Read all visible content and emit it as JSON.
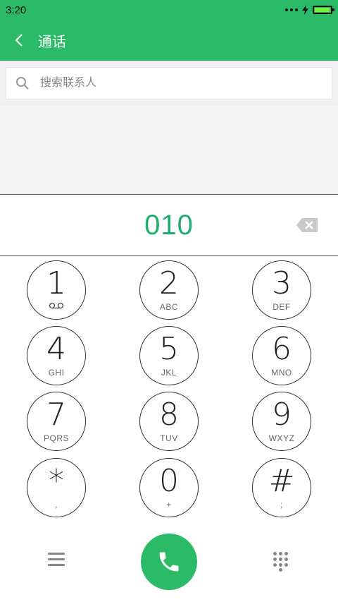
{
  "status_bar": {
    "time": "3:20",
    "battery_level": 0.95
  },
  "header": {
    "title": "通话"
  },
  "search": {
    "placeholder": "搜索联系人"
  },
  "dialer": {
    "number": "010"
  },
  "keys": [
    {
      "digit": "1",
      "sub": ""
    },
    {
      "digit": "2",
      "sub": "ABC"
    },
    {
      "digit": "3",
      "sub": "DEF"
    },
    {
      "digit": "4",
      "sub": "GHI"
    },
    {
      "digit": "5",
      "sub": "JKL"
    },
    {
      "digit": "6",
      "sub": "MNO"
    },
    {
      "digit": "7",
      "sub": "PQRS"
    },
    {
      "digit": "8",
      "sub": "TUV"
    },
    {
      "digit": "9",
      "sub": "WXYZ"
    },
    {
      "digit": "*",
      "sub": ","
    },
    {
      "digit": "0",
      "sub": "+"
    },
    {
      "digit": "#",
      "sub": ";"
    }
  ],
  "colors": {
    "accent": "#2bbb66",
    "number": "#1fae6e"
  }
}
